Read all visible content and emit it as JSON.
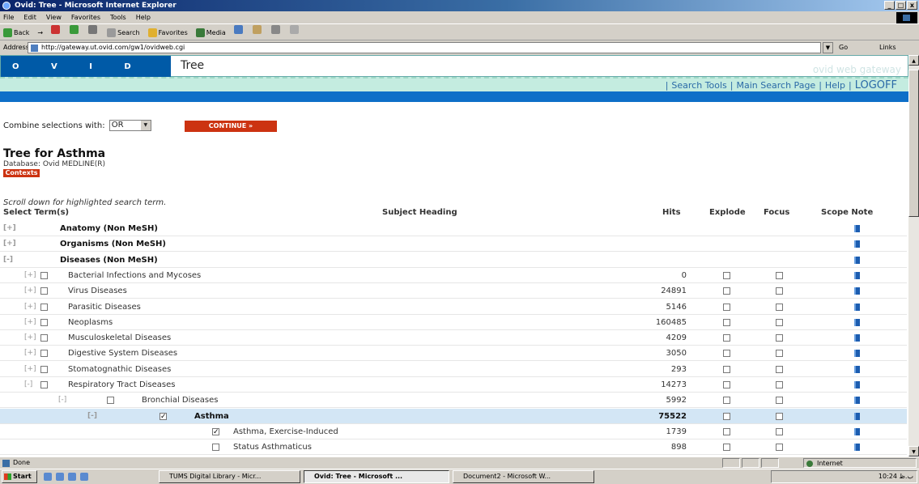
{
  "window": {
    "title": "Ovid: Tree - Microsoft Internet Explorer",
    "controls": [
      "_",
      "□",
      "x"
    ]
  },
  "menu": [
    "File",
    "Edit",
    "View",
    "Favorites",
    "Tools",
    "Help"
  ],
  "toolbar": {
    "back": "Back",
    "forward": "→",
    "search": "Search",
    "favorites": "Favorites",
    "media": "Media"
  },
  "address": {
    "label": "Address",
    "url": "http://gateway.ut.ovid.com/gw1/ovidweb.cgi",
    "go": "Go",
    "links": "Links"
  },
  "ovid": {
    "logo": "O V I D",
    "page_name": "Tree",
    "gateway": "ovid web gateway",
    "nav": {
      "search_tools": "Search Tools",
      "main_search": "Main Search Page",
      "help": "Help",
      "logoff": "LOGOFF"
    }
  },
  "combine": {
    "label": "Combine selections with:",
    "value": "OR",
    "continue": "CONTINUE »"
  },
  "tree": {
    "title": "Tree for Asthma",
    "database": "Database: Ovid MEDLINE(R)",
    "contexts": "Contexts",
    "scroll_note": "Scroll down for highlighted search term."
  },
  "columns": {
    "select": "Select Term(s)",
    "heading": "Subject Heading",
    "hits": "Hits",
    "explode": "Explode",
    "focus": "Focus",
    "scope": "Scope Note"
  },
  "rows": [
    {
      "expander": "[+]",
      "term": "Anatomy (Non MeSH)",
      "hits": "",
      "level": 0,
      "checkbox": false,
      "checked": false,
      "bold": true,
      "sel": false,
      "opts": false
    },
    {
      "expander": "[+]",
      "term": "Organisms (Non MeSH)",
      "hits": "",
      "level": 0,
      "checkbox": false,
      "checked": false,
      "bold": true,
      "sel": false,
      "opts": false
    },
    {
      "expander": "[-]",
      "term": "Diseases (Non MeSH)",
      "hits": "",
      "level": 0,
      "checkbox": false,
      "checked": false,
      "bold": true,
      "sel": false,
      "opts": false
    },
    {
      "expander": "[+]",
      "term": "Bacterial Infections and Mycoses",
      "hits": "0",
      "level": 1,
      "checkbox": true,
      "checked": false,
      "bold": false,
      "sel": false,
      "opts": true
    },
    {
      "expander": "[+]",
      "term": "Virus Diseases",
      "hits": "24891",
      "level": 1,
      "checkbox": true,
      "checked": false,
      "bold": false,
      "sel": false,
      "opts": true
    },
    {
      "expander": "[+]",
      "term": "Parasitic Diseases",
      "hits": "5146",
      "level": 1,
      "checkbox": true,
      "checked": false,
      "bold": false,
      "sel": false,
      "opts": true
    },
    {
      "expander": "[+]",
      "term": "Neoplasms",
      "hits": "160485",
      "level": 1,
      "checkbox": true,
      "checked": false,
      "bold": false,
      "sel": false,
      "opts": true
    },
    {
      "expander": "[+]",
      "term": "Musculoskeletal Diseases",
      "hits": "4209",
      "level": 1,
      "checkbox": true,
      "checked": false,
      "bold": false,
      "sel": false,
      "opts": true
    },
    {
      "expander": "[+]",
      "term": "Digestive System Diseases",
      "hits": "3050",
      "level": 1,
      "checkbox": true,
      "checked": false,
      "bold": false,
      "sel": false,
      "opts": true
    },
    {
      "expander": "[+]",
      "term": "Stomatognathic Diseases",
      "hits": "293",
      "level": 1,
      "checkbox": true,
      "checked": false,
      "bold": false,
      "sel": false,
      "opts": true
    },
    {
      "expander": "[-]",
      "term": "Respiratory Tract Diseases",
      "hits": "14273",
      "level": 1,
      "checkbox": true,
      "checked": false,
      "bold": false,
      "sel": false,
      "opts": true
    },
    {
      "expander": "[-]",
      "term": "Bronchial Diseases",
      "hits": "5992",
      "level": 2,
      "checkbox": true,
      "checked": false,
      "bold": false,
      "sel": false,
      "opts": true
    },
    {
      "expander": "[-]",
      "term": "Asthma",
      "hits": "75522",
      "level": 3,
      "checkbox": true,
      "checked": true,
      "bold": true,
      "sel": true,
      "opts": true
    },
    {
      "expander": "",
      "term": "Asthma, Exercise-Induced",
      "hits": "1739",
      "level": 4,
      "checkbox": true,
      "checked": true,
      "bold": false,
      "sel": false,
      "opts": true
    },
    {
      "expander": "",
      "term": "Status Asthmaticus",
      "hits": "898",
      "level": 4,
      "checkbox": true,
      "checked": false,
      "bold": false,
      "sel": false,
      "opts": true
    }
  ],
  "status": {
    "text": "Done",
    "zone": "Internet"
  },
  "taskbar": {
    "start": "Start",
    "tasks": [
      "TUMS Digital Library - Micr...",
      "Ovid: Tree - Microsoft ...",
      "Document2 - Microsoft W..."
    ],
    "clock": "10:24 ب.ظ"
  }
}
